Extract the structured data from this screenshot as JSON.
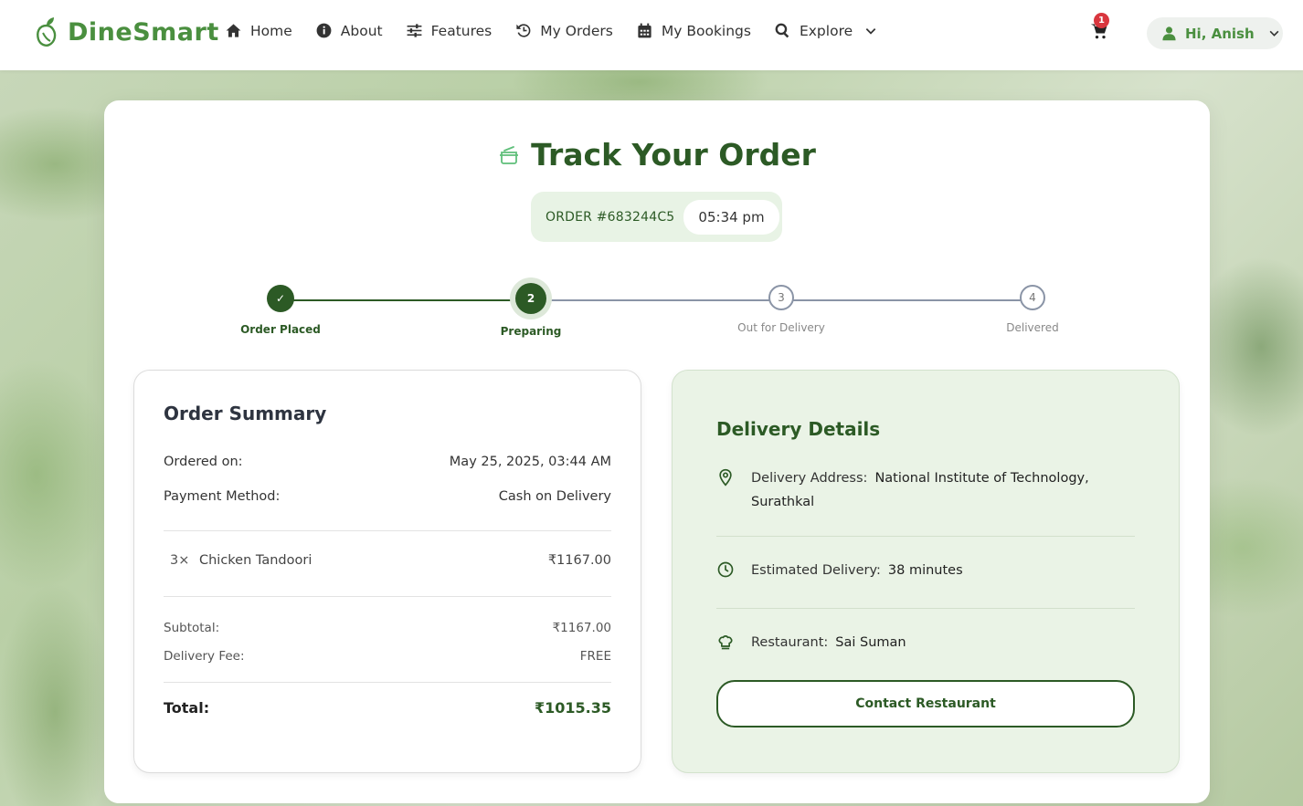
{
  "nav": {
    "brand": "DineSmart",
    "links": [
      {
        "label": "Home",
        "icon": "home-icon"
      },
      {
        "label": "About",
        "icon": "info-icon"
      },
      {
        "label": "Features",
        "icon": "sliders-icon"
      },
      {
        "label": "My Orders",
        "icon": "history-icon"
      },
      {
        "label": "My Bookings",
        "icon": "calendar-icon"
      },
      {
        "label": "Explore",
        "icon": "search-icon"
      }
    ],
    "cart_count": "1",
    "user_greeting": "Hi, Anish"
  },
  "page": {
    "title": "Track Your Order",
    "order_id": "ORDER #683244C5",
    "order_time": "05:34 pm"
  },
  "stepper": {
    "steps": [
      {
        "label": "Order Placed",
        "marker": "✓",
        "state": "done"
      },
      {
        "label": "Preparing",
        "marker": "2",
        "state": "active"
      },
      {
        "label": "Out for Delivery",
        "marker": "3",
        "state": "pending"
      },
      {
        "label": "Delivered",
        "marker": "4",
        "state": "pending"
      }
    ]
  },
  "summary": {
    "title": "Order Summary",
    "ordered_on_label": "Ordered on:",
    "ordered_on_value": "May 25, 2025, 03:44 AM",
    "payment_label": "Payment Method:",
    "payment_value": "Cash on Delivery",
    "items": [
      {
        "qty": "3×",
        "name": "Chicken Tandoori",
        "price": "₹1167.00"
      }
    ],
    "subtotal_label": "Subtotal:",
    "subtotal_value": "₹1167.00",
    "delivery_fee_label": "Delivery Fee:",
    "delivery_fee_value": "FREE",
    "total_label": "Total:",
    "total_value": "₹1015.35"
  },
  "delivery": {
    "title": "Delivery Details",
    "address_label": "Delivery Address:",
    "address_value_line1": "National Institute of Technology,",
    "address_value_line2": "Surathkal",
    "eta_label": "Estimated Delivery:",
    "eta_value": "38 minutes",
    "restaurant_label": "Restaurant:",
    "restaurant_value": "Sai Suman",
    "contact_button": "Contact Restaurant"
  },
  "colors": {
    "brand_green": "#4a8f3f",
    "dark_green": "#2c5a25",
    "badge_red": "#d9363e"
  }
}
